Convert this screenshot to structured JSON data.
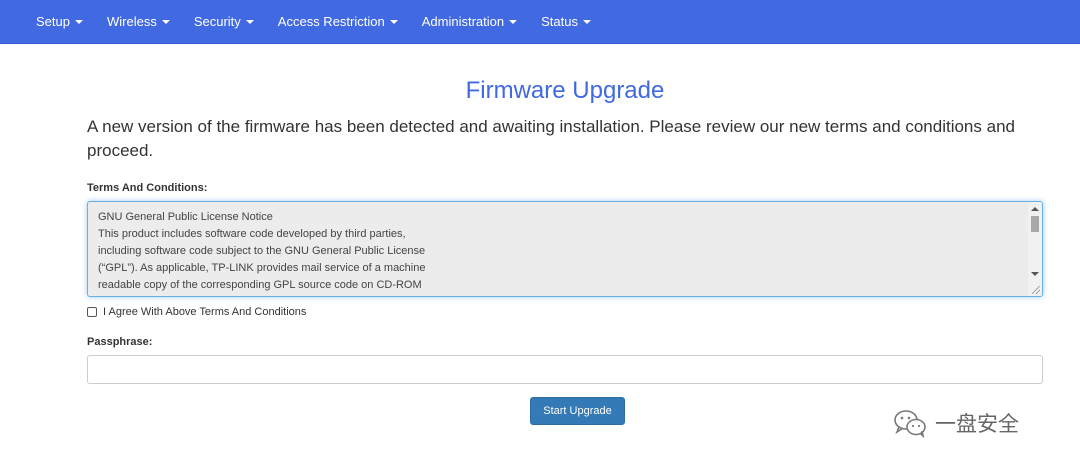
{
  "nav": {
    "items": [
      {
        "label": "Setup"
      },
      {
        "label": "Wireless"
      },
      {
        "label": "Security"
      },
      {
        "label": "Access Restriction"
      },
      {
        "label": "Administration"
      },
      {
        "label": "Status"
      }
    ]
  },
  "main": {
    "title": "Firmware Upgrade",
    "lead": "A new version of the firmware has been detected and awaiting installation. Please review our new terms and conditions and proceed.",
    "terms_label": "Terms And Conditions:",
    "terms_text": "GNU General Public License Notice\nThis product includes software code developed by third parties,\nincluding software code subject to the GNU General Public License\n(“GPL”). As applicable, TP-LINK provides mail service of a machine\nreadable copy of the corresponding GPL source code on CD-ROM",
    "agree_label": "I Agree With Above Terms And Conditions",
    "agree_checked": false,
    "passphrase_label": "Passphrase:",
    "passphrase_value": "",
    "start_button": "Start Upgrade"
  },
  "watermark": {
    "text": "一盘安全",
    "icon": "wechat-icon"
  },
  "colors": {
    "navbar": "#4169e1",
    "title": "#4169e1",
    "button": "#337ab7"
  }
}
